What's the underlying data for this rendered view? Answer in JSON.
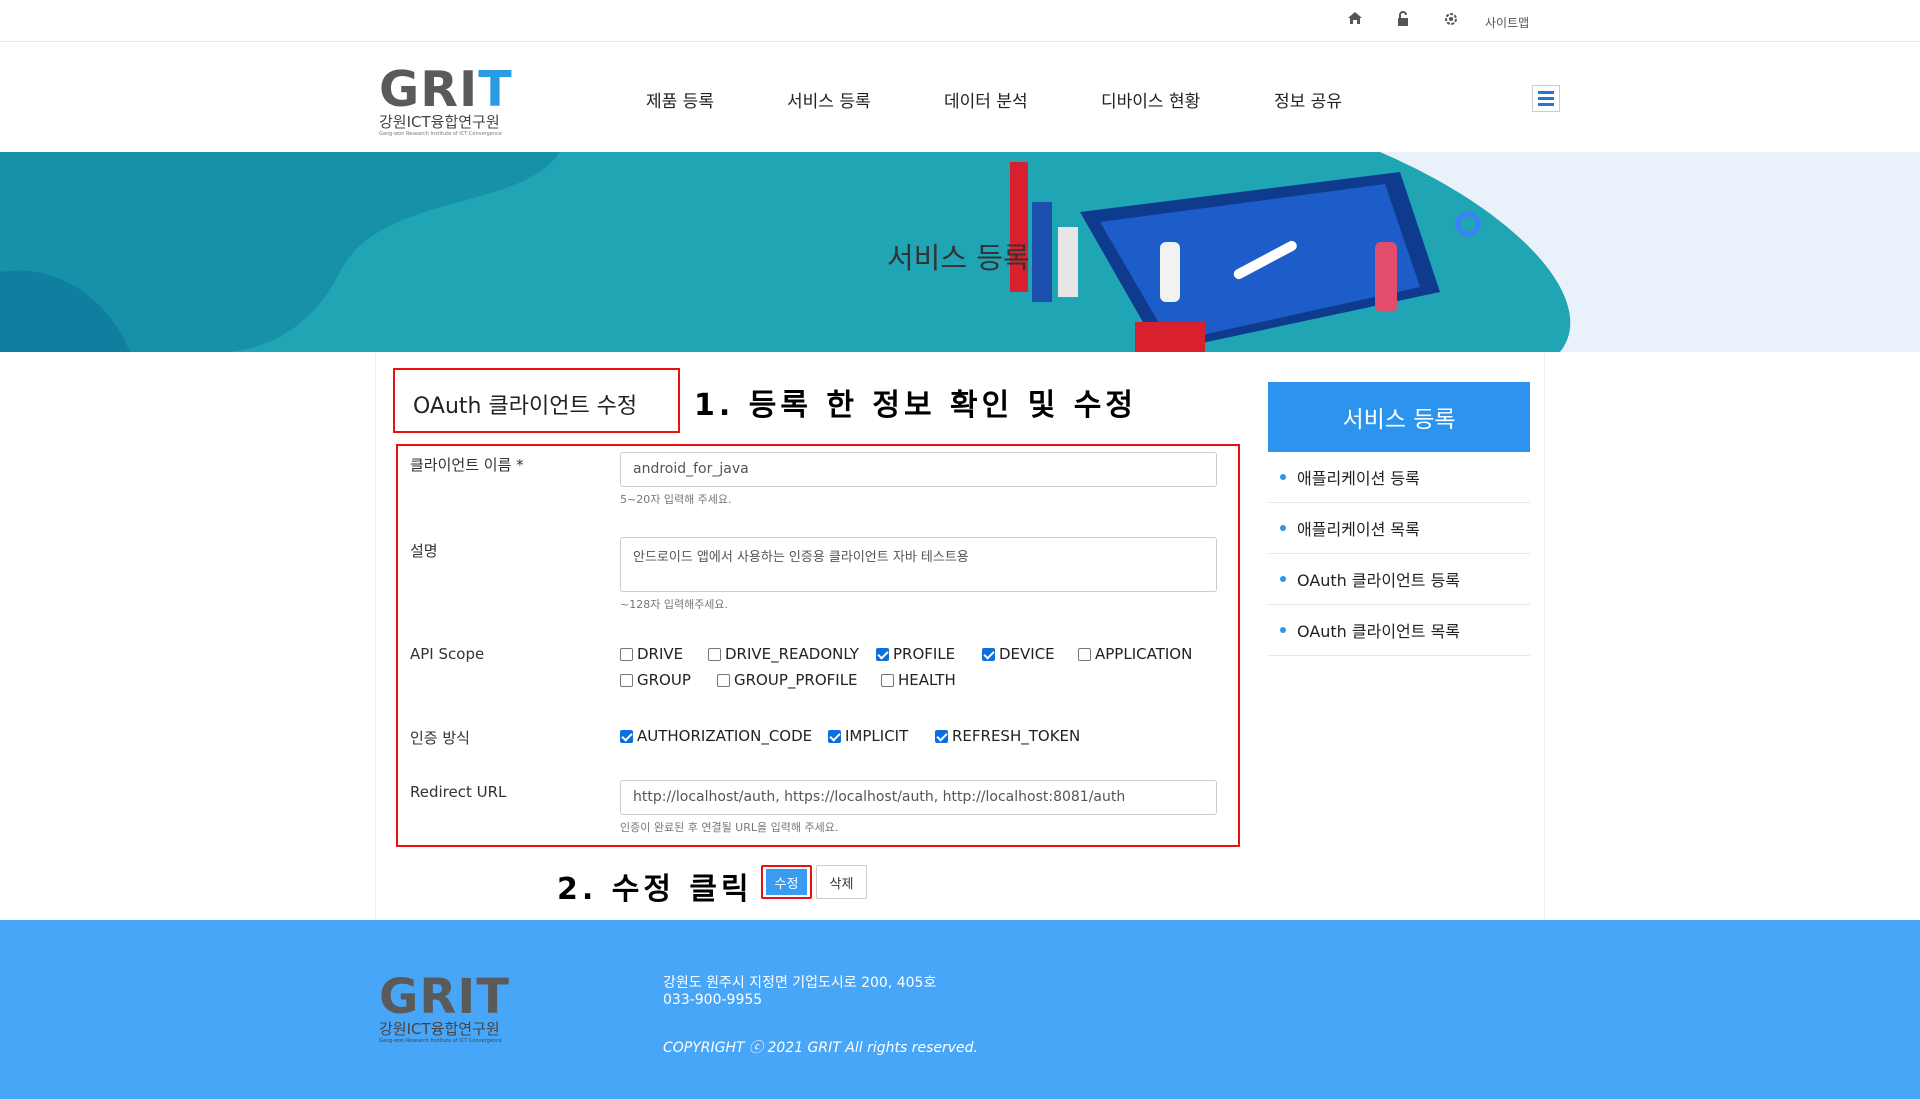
{
  "topbar": {
    "sitemap_label": "사이트맵",
    "icons": [
      "home-icon",
      "lock-icon",
      "gear-icon"
    ]
  },
  "logo": {
    "big": "GRIT",
    "kr": "강원ICT융합연구원",
    "en": "Gang-won Research Institute of ICT Convergence"
  },
  "nav": [
    "제품 등록",
    "서비스 등록",
    "데이터 분석",
    "디바이스 현황",
    "정보 공유"
  ],
  "banner": {
    "title": "서비스 등록"
  },
  "form": {
    "title": "OAuth 클라이언트 수정",
    "annotation_1": "1. 등록 한 정보 확인 및 수정",
    "annotation_2": "2. 수정 클릭",
    "client_name": {
      "label": "클라이언트 이름 *",
      "value": "android_for_java",
      "help": "5~20자 입력해 주세요."
    },
    "description": {
      "label": "설명",
      "value": "안드로이드 앱에서 사용하는 인증용 클라이언트 자바 테스트용",
      "help": "~128자 입력해주세요."
    },
    "api_scope": {
      "label": "API Scope",
      "options": [
        {
          "name": "DRIVE",
          "checked": false
        },
        {
          "name": "DRIVE_READONLY",
          "checked": false
        },
        {
          "name": "PROFILE",
          "checked": true
        },
        {
          "name": "DEVICE",
          "checked": true
        },
        {
          "name": "APPLICATION",
          "checked": false
        },
        {
          "name": "GROUP",
          "checked": false
        },
        {
          "name": "GROUP_PROFILE",
          "checked": false
        },
        {
          "name": "HEALTH",
          "checked": false
        }
      ]
    },
    "auth_method": {
      "label": "인증 방식",
      "options": [
        {
          "name": "AUTHORIZATION_CODE",
          "checked": true
        },
        {
          "name": "IMPLICIT",
          "checked": true
        },
        {
          "name": "REFRESH_TOKEN",
          "checked": true
        }
      ]
    },
    "redirect_url": {
      "label": "Redirect URL",
      "value": "http://localhost/auth, https://localhost/auth, http://localhost:8081/auth",
      "help": "인증이 완료된 후 연결될 URL을 입력해 주세요."
    },
    "buttons": {
      "edit": "수정",
      "delete": "삭제"
    }
  },
  "sidebar": {
    "title": "서비스 등록",
    "items": [
      "애플리케이션 등록",
      "애플리케이션 목록",
      "OAuth 클라이언트 등록",
      "OAuth 클라이언트 목록"
    ]
  },
  "footer": {
    "address": "강원도 원주시 지정면 기업도시로 200, 405호",
    "phone": "033-900-9955",
    "copyright": "COPYRIGHT ⓒ 2021 GRIT All rights reserved."
  },
  "colors": {
    "accent": "#2c94ee",
    "banner": "#1fa5b4",
    "footer": "#48a6f8",
    "annotation": "#e81010"
  }
}
